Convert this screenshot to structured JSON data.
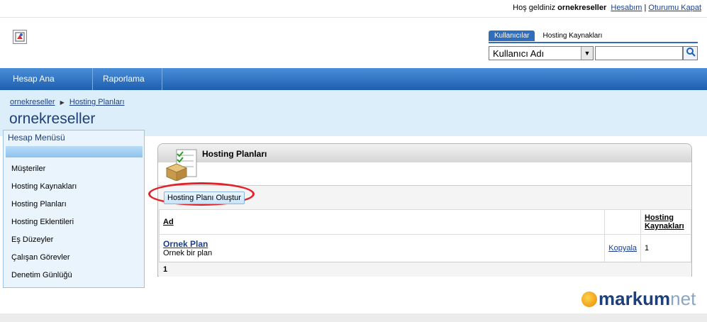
{
  "header": {
    "welcome_prefix": "Hoş geldiniz",
    "username": "ornekreseller",
    "account_link": "Hesabım",
    "separator": "|",
    "logout_link": "Oturumu Kapat"
  },
  "search": {
    "tab_users": "Kullanıcılar",
    "tab_hosting": "Hosting Kaynakları",
    "select_value": "Kullanıcı Adı",
    "input_value": ""
  },
  "nav": {
    "home": "Hesap Ana Sayfası",
    "reports": "Raporlama"
  },
  "breadcrumb": {
    "root": "ornekreseller",
    "current": "Hosting Planları"
  },
  "page_title": "ornekreseller",
  "sidebar": {
    "title": "Hesap Menüsü",
    "items": [
      {
        "label": "Müşteriler"
      },
      {
        "label": "Hosting Kaynakları"
      },
      {
        "label": "Hosting Planları"
      },
      {
        "label": "Hosting Eklentileri"
      },
      {
        "label": "Eş Düzeyler"
      },
      {
        "label": "Çalışan Görevler"
      },
      {
        "label": "Denetim Günlüğü"
      }
    ]
  },
  "panel": {
    "title": "Hosting Planları",
    "create_button": "Hosting Planı Oluştur",
    "columns": {
      "name": "Ad",
      "action": "",
      "resources_line1": "Hosting",
      "resources_line2": "Kaynakları"
    },
    "rows": [
      {
        "name": "Ornek Plan",
        "description": "Ornek bir plan",
        "action": "Kopyala",
        "resources": "1"
      }
    ],
    "pager": "1"
  },
  "brand": {
    "main": "markum",
    "suffix": "net"
  },
  "colors": {
    "nav_blue": "#2f6dbd",
    "highlight_red": "#e0222a"
  }
}
